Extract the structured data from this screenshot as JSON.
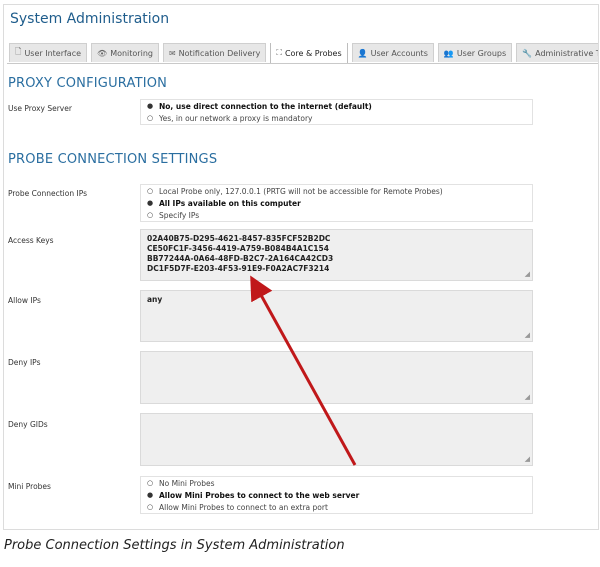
{
  "window": {
    "title": "System Administration"
  },
  "tabs": [
    {
      "label": "User Interface",
      "icon": "page-icon",
      "glyph": "🗋"
    },
    {
      "label": "Monitoring",
      "icon": "eye-icon",
      "glyph": "👁"
    },
    {
      "label": "Notification Delivery",
      "icon": "envelope-icon",
      "glyph": "✉"
    },
    {
      "label": "Core & Probes",
      "icon": "nodes-icon",
      "glyph": "⛶",
      "active": true
    },
    {
      "label": "User Accounts",
      "icon": "user-icon",
      "glyph": "👤"
    },
    {
      "label": "User Groups",
      "icon": "users-icon",
      "glyph": "👥"
    },
    {
      "label": "Administrative Too",
      "icon": "wrench-icon",
      "glyph": "🔧"
    }
  ],
  "proxy": {
    "section_title": "PROXY CONFIGURATION",
    "use_proxy_label": "Use Proxy Server",
    "options": [
      {
        "label": "No, use direct connection to the internet (default)",
        "selected": true
      },
      {
        "label": "Yes, in our network a proxy is mandatory",
        "selected": false
      }
    ]
  },
  "probe": {
    "section_title": "PROBE CONNECTION SETTINGS",
    "ips_label": "Probe Connection IPs",
    "ips_options": [
      {
        "label": "Local Probe only, 127.0.0.1 (PRTG will not be accessible for Remote Probes)",
        "selected": false
      },
      {
        "label": "All IPs available on this computer",
        "selected": true
      },
      {
        "label": "Specify IPs",
        "selected": false
      }
    ],
    "access_keys_label": "Access Keys",
    "access_keys": [
      "02A40B75-D295-4621-8457-835FCF52B2DC",
      "CE50FC1F-3456-4419-A759-B084B4A1C154",
      "BB77244A-0A64-48FD-B2C7-2A164CA42CD3",
      "DC1F5D7F-E203-4F53-91E9-F0A2AC7F3214"
    ],
    "allow_ips_label": "Allow IPs",
    "allow_ips_value": "any",
    "deny_ips_label": "Deny IPs",
    "deny_ips_value": "",
    "deny_gids_label": "Deny GIDs",
    "deny_gids_value": "",
    "mini_probes_label": "Mini Probes",
    "mini_probes_options": [
      {
        "label": "No Mini Probes",
        "selected": false
      },
      {
        "label": "Allow Mini Probes to connect to the web server",
        "selected": true
      },
      {
        "label": "Allow Mini Probes to connect to an extra port",
        "selected": false
      }
    ]
  },
  "caption": "Probe Connection Settings in System Administration",
  "colors": {
    "title": "#1f5d8c",
    "section": "#2a6ea0",
    "arrow": "#c0181a"
  },
  "glyphs": {
    "radio_on": "●",
    "radio_off": "○",
    "grip": "◢"
  }
}
